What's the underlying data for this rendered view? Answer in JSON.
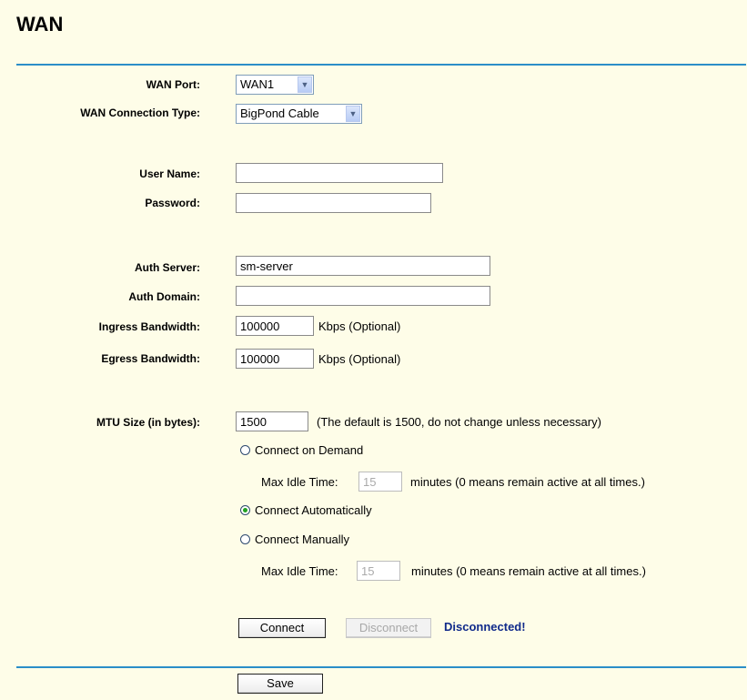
{
  "page": {
    "title": "WAN"
  },
  "form": {
    "wan_port": {
      "label": "WAN Port:",
      "value": "WAN1"
    },
    "connection_type": {
      "label": "WAN Connection Type:",
      "value": "BigPond Cable"
    },
    "user_name": {
      "label": "User Name:",
      "value": ""
    },
    "password": {
      "label": "Password:",
      "value": ""
    },
    "auth_server": {
      "label": "Auth Server:",
      "value": "sm-server"
    },
    "auth_domain": {
      "label": "Auth Domain:",
      "value": ""
    },
    "ingress": {
      "label": "Ingress Bandwidth:",
      "value": "100000",
      "unit": "Kbps (Optional)"
    },
    "egress": {
      "label": "Egress Bandwidth:",
      "value": "100000",
      "unit": "Kbps (Optional)"
    },
    "mtu": {
      "label": "MTU Size (in bytes):",
      "value": "1500",
      "note": "(The default is 1500, do not change unless necessary)"
    }
  },
  "connection_modes": {
    "on_demand": {
      "label": "Connect on Demand",
      "checked": false
    },
    "automatic": {
      "label": "Connect Automatically",
      "checked": true
    },
    "manual": {
      "label": "Connect Manually",
      "checked": false
    },
    "idle_label": "Max Idle Time:",
    "idle_value_demand": "15",
    "idle_value_manual": "15",
    "idle_note": "minutes (0 means remain active at all times.)"
  },
  "actions": {
    "connect_label": "Connect",
    "disconnect_label": "Disconnect",
    "status_text": "Disconnected!",
    "save_label": "Save"
  },
  "colors": {
    "background": "#fefde8",
    "divider": "#2b8ec8",
    "status": "#102a8a"
  }
}
